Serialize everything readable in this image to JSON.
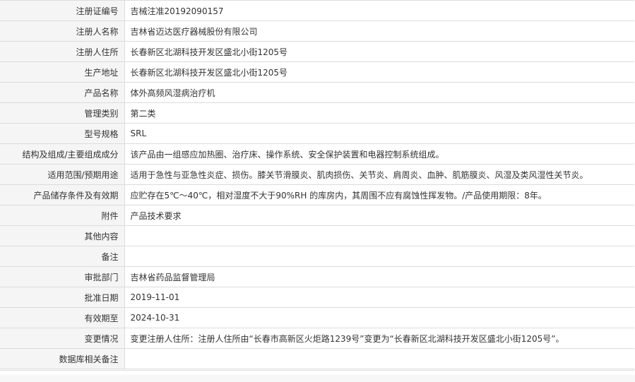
{
  "rows": [
    {
      "label": "注册证编号",
      "value": "吉械注准20192090157"
    },
    {
      "label": "注册人名称",
      "value": "吉林省迈达医疗器械股份有限公司"
    },
    {
      "label": "注册人住所",
      "value": "长春新区北湖科技开发区盛北小街1205号"
    },
    {
      "label": "生产地址",
      "value": "长春新区北湖科技开发区盛北小街1205号"
    },
    {
      "label": "产品名称",
      "value": "体外高频风湿病治疗机"
    },
    {
      "label": "管理类别",
      "value": "第二类"
    },
    {
      "label": "型号规格",
      "value": "SRL"
    },
    {
      "label": "结构及组成/主要组成成分",
      "value": "该产品由一组感应加热圈、治疗床、操作系统、安全保护装置和电器控制系统组成。"
    },
    {
      "label": "适用范围/预期用途",
      "value": "适用于急性与亚急性炎症、损伤。膝关节滑膜炎、肌肉损伤、关节炎、肩周炎、血肿、肌筋膜炎、风湿及类风湿性关节炎。"
    },
    {
      "label": "产品储存条件及有效期",
      "value": "应贮存在5℃～40℃，相对湿度不大于90%RH 的库房内，其周围不应有腐蚀性挥发物。/产品使用期限：8年。"
    },
    {
      "label": "附件",
      "value": "产品技术要求"
    },
    {
      "label": "其他内容",
      "value": ""
    },
    {
      "label": "备注",
      "value": ""
    },
    {
      "label": "审批部门",
      "value": "吉林省药品监督管理局"
    },
    {
      "label": "批准日期",
      "value": "2019-11-01"
    },
    {
      "label": "有效期至",
      "value": "2024-10-31"
    },
    {
      "label": "变更情况",
      "value": "变更注册人住所：注册人住所由“长春市高新区火炬路1239号”变更为“长春新区北湖科技开发区盛北小街1205号”。"
    },
    {
      "label": "数据库相关备注",
      "value": ""
    }
  ]
}
